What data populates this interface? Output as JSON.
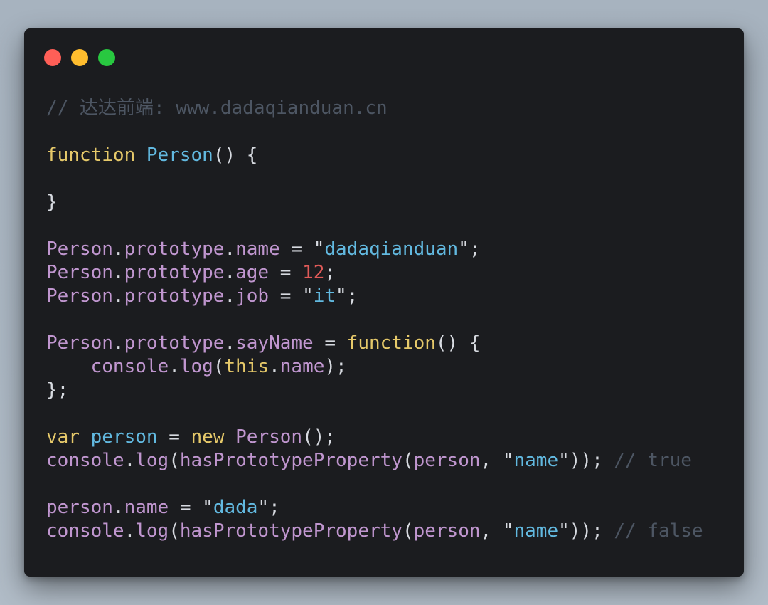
{
  "window_controls": {
    "close_color": "#ff5f57",
    "minimize_color": "#ffbd2e",
    "maximize_color": "#28c840"
  },
  "code": {
    "language": "javascript",
    "lines": [
      [
        {
          "t": "// 达达前端: www.dadaqianduan.cn",
          "c": "cm"
        }
      ],
      [],
      [
        {
          "t": "function",
          "c": "kw"
        },
        {
          "t": " ",
          "c": "pl"
        },
        {
          "t": "Person",
          "c": "fn"
        },
        {
          "t": "() {",
          "c": "pl"
        }
      ],
      [],
      [
        {
          "t": "}",
          "c": "pl"
        }
      ],
      [],
      [
        {
          "t": "Person",
          "c": "obj"
        },
        {
          "t": ".",
          "c": "pl"
        },
        {
          "t": "prototype",
          "c": "obj"
        },
        {
          "t": ".",
          "c": "pl"
        },
        {
          "t": "name",
          "c": "obj"
        },
        {
          "t": " = ",
          "c": "pl"
        },
        {
          "t": "\"",
          "c": "quote"
        },
        {
          "t": "dadaqianduan",
          "c": "str"
        },
        {
          "t": "\"",
          "c": "quote"
        },
        {
          "t": ";",
          "c": "pl"
        }
      ],
      [
        {
          "t": "Person",
          "c": "obj"
        },
        {
          "t": ".",
          "c": "pl"
        },
        {
          "t": "prototype",
          "c": "obj"
        },
        {
          "t": ".",
          "c": "pl"
        },
        {
          "t": "age",
          "c": "obj"
        },
        {
          "t": " = ",
          "c": "pl"
        },
        {
          "t": "12",
          "c": "num"
        },
        {
          "t": ";",
          "c": "pl"
        }
      ],
      [
        {
          "t": "Person",
          "c": "obj"
        },
        {
          "t": ".",
          "c": "pl"
        },
        {
          "t": "prototype",
          "c": "obj"
        },
        {
          "t": ".",
          "c": "pl"
        },
        {
          "t": "job",
          "c": "obj"
        },
        {
          "t": " = ",
          "c": "pl"
        },
        {
          "t": "\"",
          "c": "quote"
        },
        {
          "t": "it",
          "c": "str"
        },
        {
          "t": "\"",
          "c": "quote"
        },
        {
          "t": ";",
          "c": "pl"
        }
      ],
      [],
      [
        {
          "t": "Person",
          "c": "obj"
        },
        {
          "t": ".",
          "c": "pl"
        },
        {
          "t": "prototype",
          "c": "obj"
        },
        {
          "t": ".",
          "c": "pl"
        },
        {
          "t": "sayName",
          "c": "obj"
        },
        {
          "t": " = ",
          "c": "pl"
        },
        {
          "t": "function",
          "c": "kw"
        },
        {
          "t": "() {",
          "c": "pl"
        }
      ],
      [
        {
          "t": "    ",
          "c": "pl"
        },
        {
          "t": "console",
          "c": "obj"
        },
        {
          "t": ".",
          "c": "pl"
        },
        {
          "t": "log",
          "c": "obj"
        },
        {
          "t": "(",
          "c": "pl"
        },
        {
          "t": "this",
          "c": "kw"
        },
        {
          "t": ".",
          "c": "pl"
        },
        {
          "t": "name",
          "c": "obj"
        },
        {
          "t": ");",
          "c": "pl"
        }
      ],
      [
        {
          "t": "};",
          "c": "pl"
        }
      ],
      [],
      [
        {
          "t": "var",
          "c": "kw"
        },
        {
          "t": " ",
          "c": "pl"
        },
        {
          "t": "person",
          "c": "fn"
        },
        {
          "t": " = ",
          "c": "pl"
        },
        {
          "t": "new",
          "c": "kw"
        },
        {
          "t": " ",
          "c": "pl"
        },
        {
          "t": "Person",
          "c": "obj"
        },
        {
          "t": "();",
          "c": "pl"
        }
      ],
      [
        {
          "t": "console",
          "c": "obj"
        },
        {
          "t": ".",
          "c": "pl"
        },
        {
          "t": "log",
          "c": "obj"
        },
        {
          "t": "(",
          "c": "pl"
        },
        {
          "t": "hasPrototypeProperty",
          "c": "obj"
        },
        {
          "t": "(",
          "c": "pl"
        },
        {
          "t": "person",
          "c": "obj"
        },
        {
          "t": ", ",
          "c": "pl"
        },
        {
          "t": "\"",
          "c": "quote"
        },
        {
          "t": "name",
          "c": "str"
        },
        {
          "t": "\"",
          "c": "quote"
        },
        {
          "t": ")); ",
          "c": "pl"
        },
        {
          "t": "// true",
          "c": "cm"
        }
      ],
      [],
      [
        {
          "t": "person",
          "c": "obj"
        },
        {
          "t": ".",
          "c": "pl"
        },
        {
          "t": "name",
          "c": "obj"
        },
        {
          "t": " = ",
          "c": "pl"
        },
        {
          "t": "\"",
          "c": "quote"
        },
        {
          "t": "dada",
          "c": "str"
        },
        {
          "t": "\"",
          "c": "quote"
        },
        {
          "t": ";",
          "c": "pl"
        }
      ],
      [
        {
          "t": "console",
          "c": "obj"
        },
        {
          "t": ".",
          "c": "pl"
        },
        {
          "t": "log",
          "c": "obj"
        },
        {
          "t": "(",
          "c": "pl"
        },
        {
          "t": "hasPrototypeProperty",
          "c": "obj"
        },
        {
          "t": "(",
          "c": "pl"
        },
        {
          "t": "person",
          "c": "obj"
        },
        {
          "t": ", ",
          "c": "pl"
        },
        {
          "t": "\"",
          "c": "quote"
        },
        {
          "t": "name",
          "c": "str"
        },
        {
          "t": "\"",
          "c": "quote"
        },
        {
          "t": ")); ",
          "c": "pl"
        },
        {
          "t": "// false",
          "c": "cm"
        }
      ]
    ]
  }
}
